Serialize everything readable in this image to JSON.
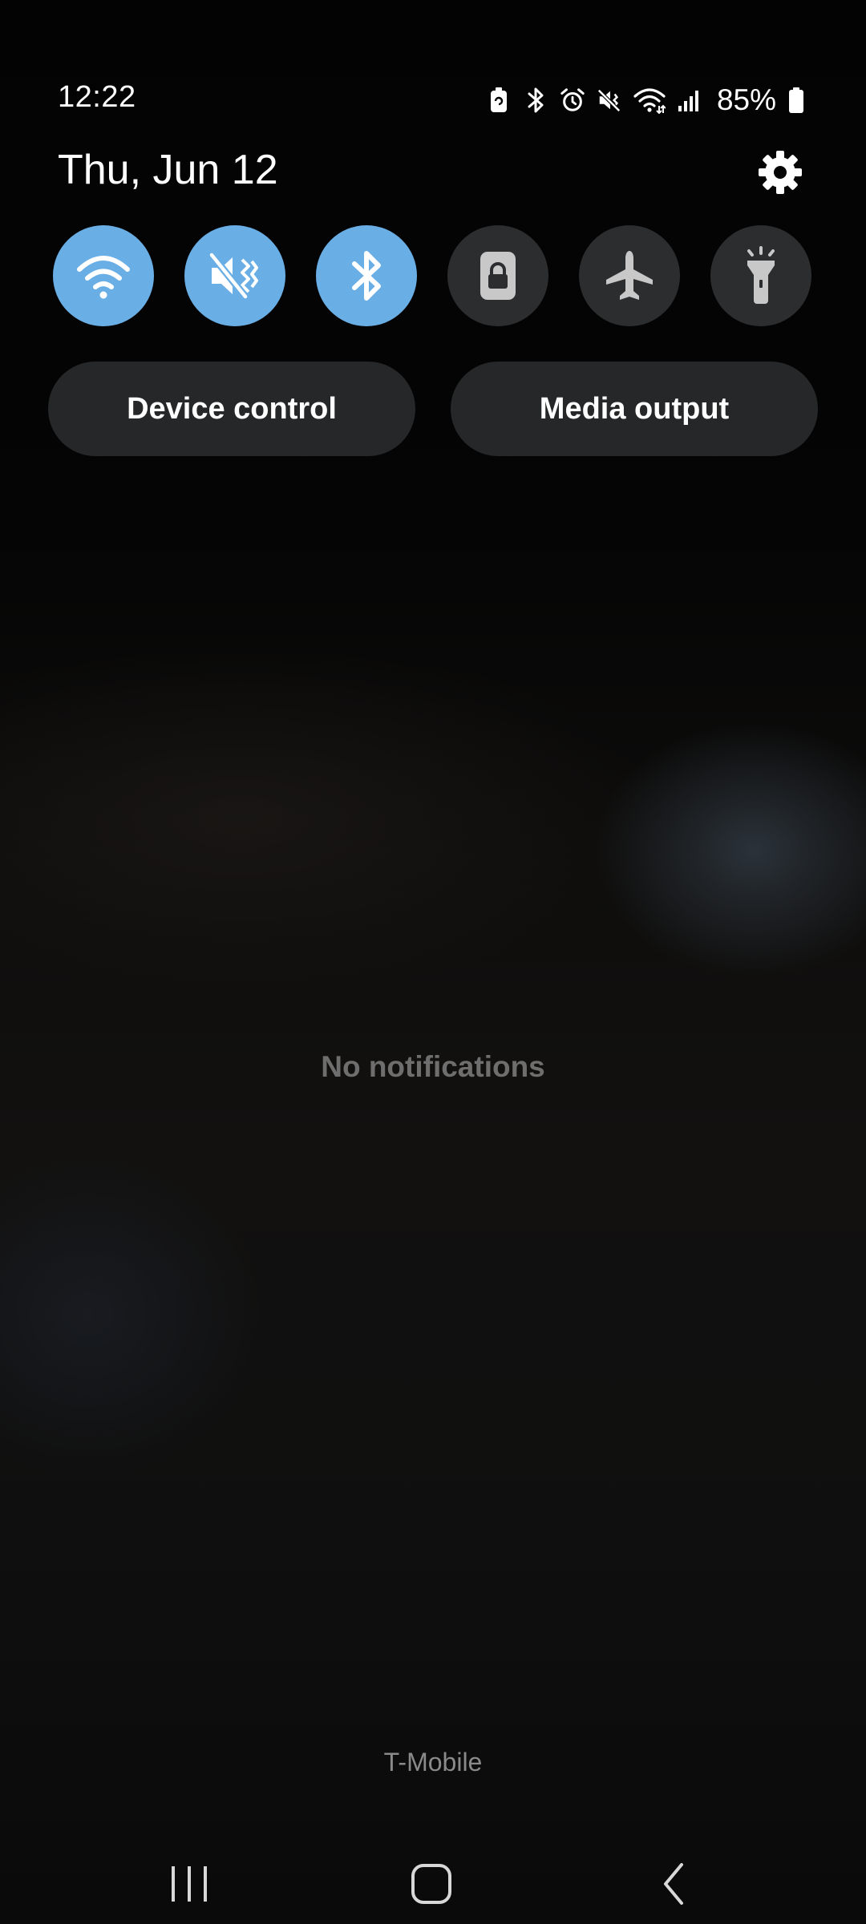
{
  "status_bar": {
    "time": "12:22",
    "battery_percent": "85%",
    "icons": [
      "battery-saver-icon",
      "bluetooth-icon",
      "alarm-icon",
      "mute-icon",
      "wifi-icon",
      "signal-icon",
      "battery-icon"
    ]
  },
  "header": {
    "date": "Thu, Jun 12",
    "settings_icon": "gear-icon"
  },
  "quick_toggles": [
    {
      "id": "wifi",
      "icon": "wifi-icon",
      "state": "on"
    },
    {
      "id": "sound",
      "icon": "mute-vibrate-icon",
      "state": "on"
    },
    {
      "id": "bluetooth",
      "icon": "bluetooth-icon",
      "state": "on"
    },
    {
      "id": "portrait-lock",
      "icon": "rotation-lock-icon",
      "state": "off"
    },
    {
      "id": "airplane",
      "icon": "airplane-icon",
      "state": "off"
    },
    {
      "id": "flashlight",
      "icon": "flashlight-icon",
      "state": "off"
    }
  ],
  "buttons": {
    "device_control": "Device control",
    "media_output": "Media output"
  },
  "notifications": {
    "empty_text": "No notifications"
  },
  "carrier": "T-Mobile",
  "colors": {
    "toggle_on": "#6aaee6",
    "toggle_off": "#2b2d2f",
    "pill_bg": "#262728",
    "background": "#050505"
  },
  "nav": {
    "icons": [
      "recent-apps-icon",
      "home-icon",
      "back-icon"
    ]
  }
}
